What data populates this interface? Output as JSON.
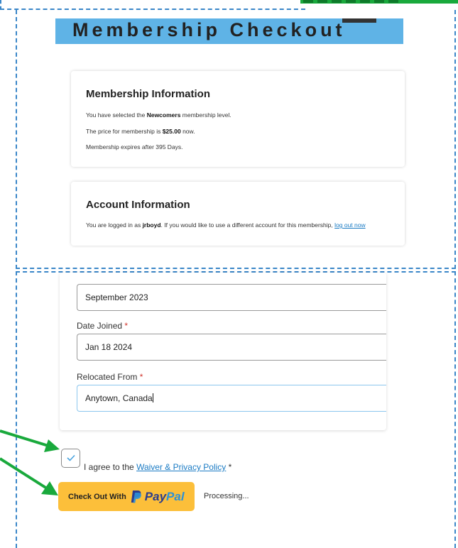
{
  "header": {
    "title": "Membership Checkout"
  },
  "membership": {
    "heading": "Membership Information",
    "line1_prefix": "You have selected the ",
    "level": "Newcomers",
    "line1_suffix": " membership level.",
    "line2_prefix": "The price for membership is ",
    "price": "$25.00",
    "line2_suffix": " now.",
    "line3": "Membership expires after 395 Days."
  },
  "account": {
    "heading": "Account Information",
    "text_prefix": "You are logged in as ",
    "username": "jrboyd",
    "text_suffix": ". If you would like to use a different account for this membership, ",
    "logout_link": "log out now"
  },
  "form": {
    "arrival_value": "September 2023",
    "date_joined_label": "Date Joined ",
    "date_joined_value": "Jan 18 2024",
    "relocated_label": "Relocated From ",
    "relocated_value": "Anytown, Canada",
    "required_mark": "*"
  },
  "agree": {
    "prefix": "I agree to the ",
    "link": "Waiver & Privacy Policy",
    "suffix": " *"
  },
  "paypal": {
    "prefix": "Check Out With",
    "brand_pay": "Pay",
    "brand_pal": "Pal"
  },
  "status": {
    "processing": "Processing..."
  },
  "colors": {
    "header_band": "#5fb3e6",
    "paypal_button": "#fcbf3a",
    "link": "#1a7bc4",
    "annotation_arrow": "#19a93c",
    "dashed_border": "#3a86c8"
  }
}
